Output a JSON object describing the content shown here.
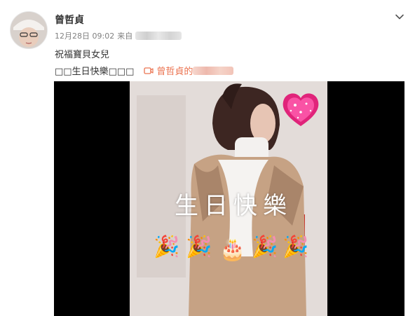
{
  "post": {
    "username": "曾哲貞",
    "timestamp": "12月28日 09:02",
    "source_prefix": "来自",
    "text_line1": "祝福寶貝女兒",
    "text_line2": "□□生日快樂□□□",
    "link_text": "曾哲貞的"
  },
  "video": {
    "overlay_text": "生日快樂",
    "emojis": [
      "🎉",
      "🎉",
      "🎂",
      "🎉",
      "🎉"
    ]
  },
  "icons": {
    "more": "chevron-down-icon",
    "link": "video-camera-icon",
    "heart": "glitter-heart-sticker"
  },
  "colors": {
    "link": "#eb7350",
    "meta": "#808080",
    "username": "#333333",
    "video_bg": "#000000"
  }
}
